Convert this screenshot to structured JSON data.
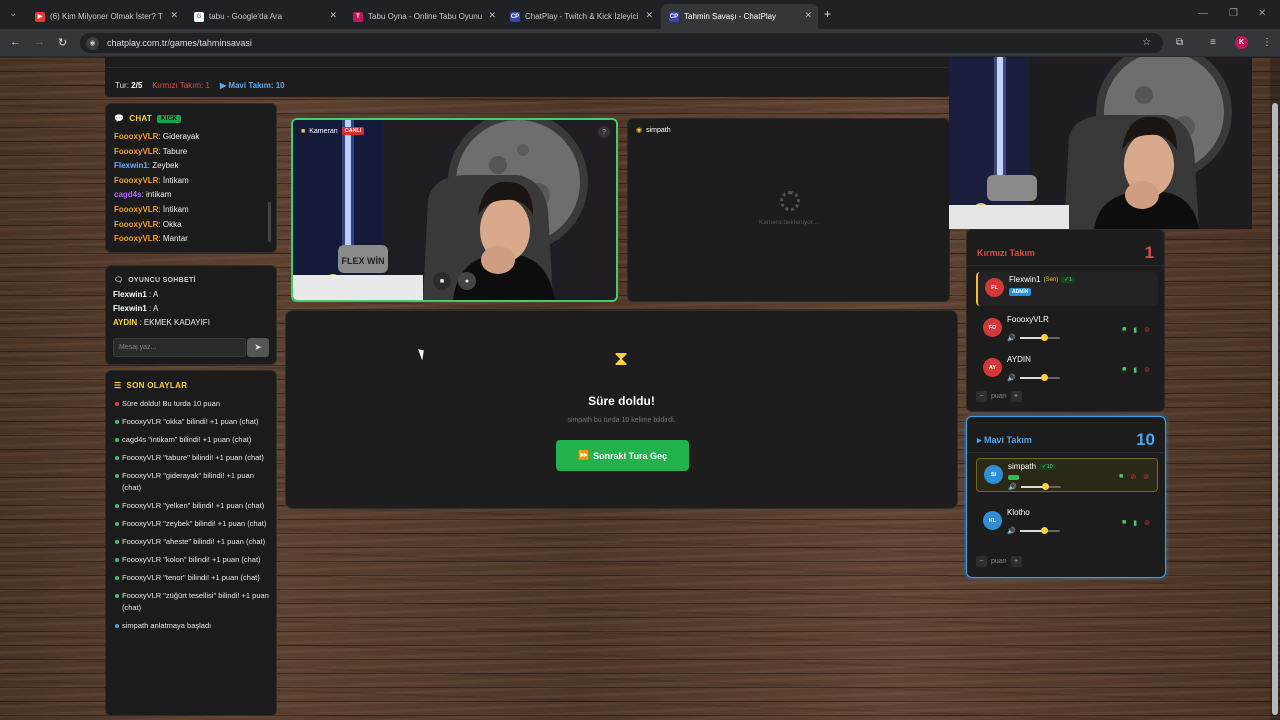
{
  "browser": {
    "tabs": [
      {
        "title": "(6) Kim Milyoner Olmak İster? T",
        "color": "#e53935",
        "glyph": "▶",
        "active": false
      },
      {
        "title": "tabu - Google'da Ara",
        "color": "#ffffff",
        "glyph": "G",
        "active": false
      },
      {
        "title": "Tabu Oyna - Online Tabu Oyunu",
        "color": "#c2185b",
        "glyph": "T",
        "active": false
      },
      {
        "title": "ChatPlay - Twitch & Kick İzleyici",
        "color": "#3949ab",
        "glyph": "CP",
        "active": false
      },
      {
        "title": "Tahmin Savaşı - ChatPlay",
        "color": "#3949ab",
        "glyph": "CP",
        "active": true
      }
    ],
    "new_tab_icon": "plus-icon",
    "url": "chatplay.com.tr/games/tahminsavasi",
    "profile_initial": "K"
  },
  "game": {
    "round_label": "Tur:",
    "round_value": "2/5",
    "red_label": "Kırmızı Takım: 1",
    "blue_label": "Mavi Takım: 10"
  },
  "chat": {
    "title": "CHAT",
    "badge": "KICK",
    "messages": [
      {
        "user": "FoooxyVLR",
        "text": "Giderayak",
        "cls": "u1"
      },
      {
        "user": "FoooxyVLR",
        "text": "Tabure",
        "cls": "u1"
      },
      {
        "user": "Flexwin1",
        "text": "Zeybek",
        "cls": "u2"
      },
      {
        "user": "FoooxyVLR",
        "text": "İntikam",
        "cls": "u1"
      },
      {
        "user": "cagd4s",
        "text": "intikam",
        "cls": "u3"
      },
      {
        "user": "FoooxyVLR",
        "text": "İntikam",
        "cls": "u1"
      },
      {
        "user": "FoooxyVLR",
        "text": "Okka",
        "cls": "u1"
      },
      {
        "user": "FoooxyVLR",
        "text": "Mantar",
        "cls": "u1"
      }
    ]
  },
  "player_chat": {
    "title": "OYUNCU SOHBETİ",
    "messages": [
      {
        "user": "Flexwin1",
        "text": "A",
        "cls": "n"
      },
      {
        "user": "Flexwin1",
        "text": "A",
        "cls": "n"
      },
      {
        "user": "AYDIN",
        "text": "EKMEK KADAYIFI",
        "cls": "n2"
      }
    ],
    "input_placeholder": "Mesaj yaz..."
  },
  "events": {
    "title": "SON OLAYLAR",
    "items": [
      {
        "text": "Süre doldu! Bu turda 10 puan",
        "kind": "red"
      },
      {
        "text": "FoooxyVLR \"okka\" bilindi! +1 puan (chat)",
        "kind": "green"
      },
      {
        "text": "cagd4s \"intikam\" bilindi! +1 puan (chat)",
        "kind": "green"
      },
      {
        "text": "FoooxyVLR \"tabure\" bilindi! +1 puan (chat)",
        "kind": "green"
      },
      {
        "text": "FoooxyVLR \"giderayak\" bilindi! +1 puan (chat)",
        "kind": "green"
      },
      {
        "text": "FoooxyVLR \"yelken\" bilindi! +1 puan (chat)",
        "kind": "green"
      },
      {
        "text": "FoooxyVLR \"zeybek\" bilindi! +1 puan (chat)",
        "kind": "green"
      },
      {
        "text": "FoooxyVLR \"aheste\" bilindi! +1 puan (chat)",
        "kind": "green"
      },
      {
        "text": "FoooxyVLR \"kolon\" bilindi! +1 puan (chat)",
        "kind": "green"
      },
      {
        "text": "FoooxyVLR \"tenor\" bilindi! +1 puan (chat)",
        "kind": "green"
      },
      {
        "text": "FoooxyVLR \"züğürt tesellisi\" bilindi! +1 puan (chat)",
        "kind": "green"
      },
      {
        "text": "simpath anlatmaya başladı",
        "kind": "blue"
      }
    ]
  },
  "cameras": {
    "own_label": "Kameran",
    "live_badge": "CANLI",
    "help": "?",
    "other_label": "simpath",
    "waiting": "Kamera bekleniyor...",
    "pillow_text": "FLEX WİN"
  },
  "result": {
    "title": "Süre doldu!",
    "subtitle": "simpath bu turda 10 kelime bildirdi.",
    "next_button": "Sonraki Tura Geç"
  },
  "teams": {
    "red": {
      "name": "Kırmızı Takım",
      "score": "1",
      "members": [
        {
          "initials": "FL",
          "name": "Flexwin1",
          "sen": "(Sen)",
          "check": "✓1",
          "badge": "ADMİN",
          "mic_on": true,
          "me": true
        },
        {
          "initials": "FO",
          "name": "FoooxyVLR",
          "volume": 0.6,
          "mic_on": true
        },
        {
          "initials": "AY",
          "name": "AYDIN",
          "volume": 0.6,
          "mic_on": true
        }
      ],
      "puan_label": "puan"
    },
    "blue": {
      "name": "Mavi Takım",
      "score": "10",
      "members": [
        {
          "initials": "SI",
          "name": "simpath",
          "check": "✓10",
          "volume": 0.6,
          "mic_on": false,
          "active": true
        },
        {
          "initials": "KL",
          "name": "Klotho",
          "volume": 0.6,
          "mic_on": true
        }
      ],
      "puan_label": "puan"
    }
  },
  "colors": {
    "accent_yellow": "#ffd23c",
    "green": "#22b24e",
    "red": "#e24848",
    "blue": "#4aa6f0"
  }
}
